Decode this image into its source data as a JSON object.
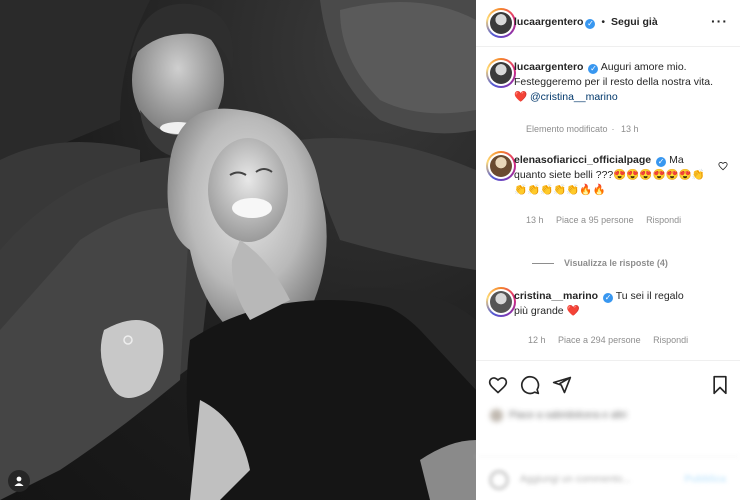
{
  "post": {
    "author": "lucaargentero",
    "follow_status": "Segui già",
    "dot": "•",
    "more_icon": "more-horizontal-icon"
  },
  "caption": {
    "author": "lucaargentero",
    "text": "Auguri amore mio. Festeggeremo per il resto della nostra vita.",
    "heart": "❤️",
    "mention": "@cristina__marino",
    "edited": "Elemento modificato",
    "time": "13 h"
  },
  "comments": [
    {
      "author": "elenasofiaricci_officialpage",
      "text": "Ma quanto siete belli ???😍😍😍😍😍😍👏👏👏👏👏👏🔥🔥",
      "time": "13 h",
      "likes": "Piace a 95 persone",
      "reply": "Rispondi"
    },
    {
      "author": "cristina__marino",
      "text": "Tu sei il regalo più grande",
      "heart": "❤️",
      "time": "12 h",
      "likes": "Piace a 294 persone",
      "reply": "Rispondi"
    }
  ],
  "view_replies": "Visualizza le risposte (4)",
  "actions": {
    "like_icon": "heart-outline-icon",
    "comment_icon": "comment-icon",
    "share_icon": "send-icon",
    "save_icon": "bookmark-icon"
  },
  "likes_summary": "Piace a sabridolcera e altri",
  "add_comment": {
    "placeholder": "Aggiungi un commento...",
    "publish": "Pubblica"
  },
  "colors": {
    "verified": "#3897f0",
    "mention": "#00376b",
    "heart": "#ed4956",
    "secondary_text": "#8e8e8e"
  }
}
